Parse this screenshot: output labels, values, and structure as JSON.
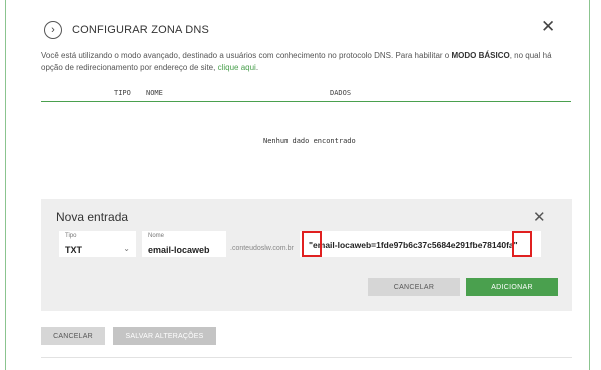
{
  "header": {
    "back_icon": "chevron-right-icon",
    "title": "CONFIGURAR ZONA DNS",
    "close_icon": "close-icon"
  },
  "description": {
    "part1": "Você está utilizando o modo avançado, destinado a usuários com conhecimento no protocolo DNS. Para habilitar o ",
    "bold": "MODO BÁSICO",
    "part2": ", no qual há opção de redirecionamento por endereço de site, ",
    "link": "clique aqui",
    "part3": "."
  },
  "table": {
    "columns": [
      "TIPO",
      "NOME",
      "DADOS"
    ],
    "empty_message": "Nenhum dado encontrado"
  },
  "new_entry": {
    "title": "Nova entrada",
    "close_icon": "close-icon",
    "type_label": "Tipo",
    "type_value": "TXT",
    "name_label": "Nome",
    "name_value": "email-locaweb",
    "domain_suffix": ".conteudoslw.com.br",
    "data_value": "\"email-locaweb=1fde97b6c37c5684e291fbe78140fa\"",
    "cancel_label": "CANCELAR",
    "add_label": "ADICIONAR"
  },
  "footer": {
    "cancel_label": "CANCELAR",
    "save_label": "SALVAR ALTERAÇÕES"
  },
  "colors": {
    "accent": "#4aa04e",
    "highlight": "#e02020"
  }
}
